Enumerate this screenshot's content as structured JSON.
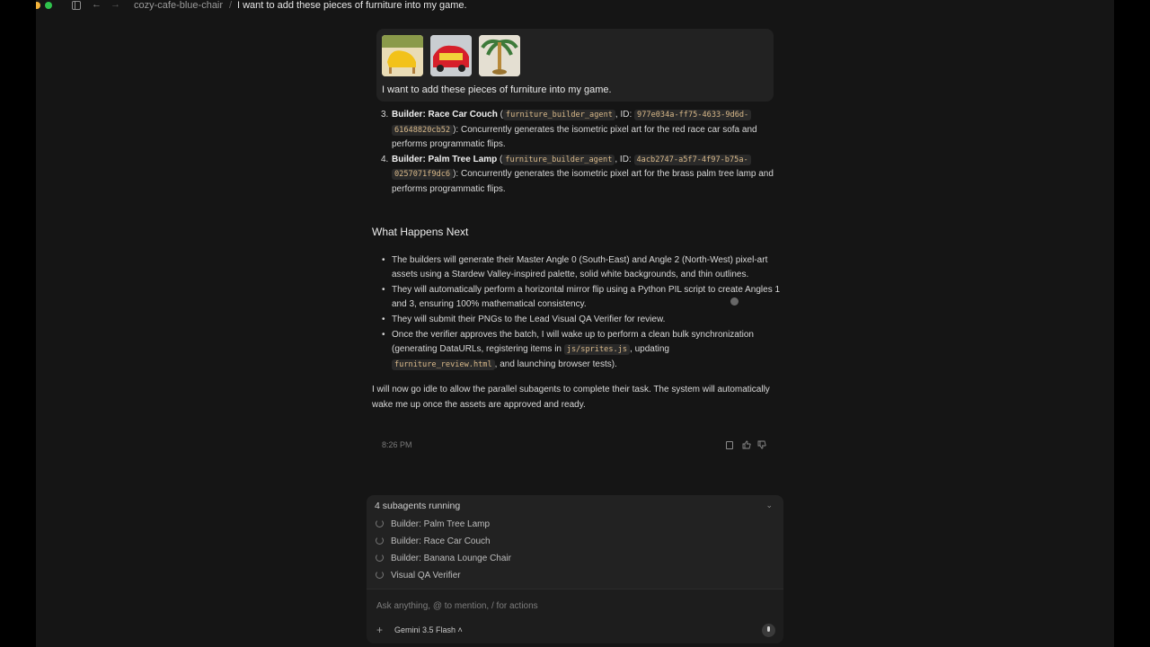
{
  "window": {
    "project": "cozy-cafe-blue-chair",
    "separator": "/",
    "title": "I want to add these pieces of furniture into my game."
  },
  "user_message": {
    "text": "I want to add these pieces of furniture into my game."
  },
  "steps": [
    {
      "num": "3.",
      "name": "Builder: Race Car Couch",
      "agent": "furniture_builder_agent",
      "id_label": ", ID:",
      "id1": "977e034a-ff75-4633-9d6d-",
      "id2": "61648820cb52",
      "desc": "): Concurrently generates the isometric pixel art for the red race car sofa and performs programmatic flips."
    },
    {
      "num": "4.",
      "name": "Builder: Palm Tree Lamp",
      "agent": "furniture_builder_agent",
      "id_label": ", ID:",
      "id1": "4acb2747-a5f7-4f97-b75a-",
      "id2": "0257071f9dc6",
      "desc": "): Concurrently generates the isometric pixel art for the brass palm tree lamp and performs programmatic flips."
    }
  ],
  "next": {
    "heading": "What Happens Next",
    "b1": "The builders will generate their Master Angle 0 (South-East) and Angle 2 (North-West) pixel-art assets using a Stardew Valley-inspired palette, solid white backgrounds, and thin outlines.",
    "b2": "They will automatically perform a horizontal mirror flip using a Python PIL script to create Angles 1 and 3, ensuring 100% mathematical consistency.",
    "b3": "They will submit their PNGs to the Lead Visual QA Verifier for review.",
    "b4a": "Once the verifier approves the batch, I will wake up to perform a clean bulk synchronization (generating DataURLs, registering items in ",
    "b4code1": "js/sprites.js",
    "b4b": ", updating",
    "b4code2": "furniture_review.html",
    "b4c": ", and launching browser tests).",
    "closing": "I will now go idle to allow the parallel subagents to complete their task. The system will automatically wake me up once the assets are approved and ready."
  },
  "timestamp": "8:26 PM",
  "subagents": {
    "title": "4 subagents running",
    "items": [
      "Builder: Palm Tree Lamp",
      "Builder: Race Car Couch",
      "Builder: Banana Lounge Chair",
      "Visual QA Verifier"
    ]
  },
  "input": {
    "placeholder": "Ask anything, @ to mention, / for actions",
    "model": "Gemini 3.5 Flash"
  }
}
